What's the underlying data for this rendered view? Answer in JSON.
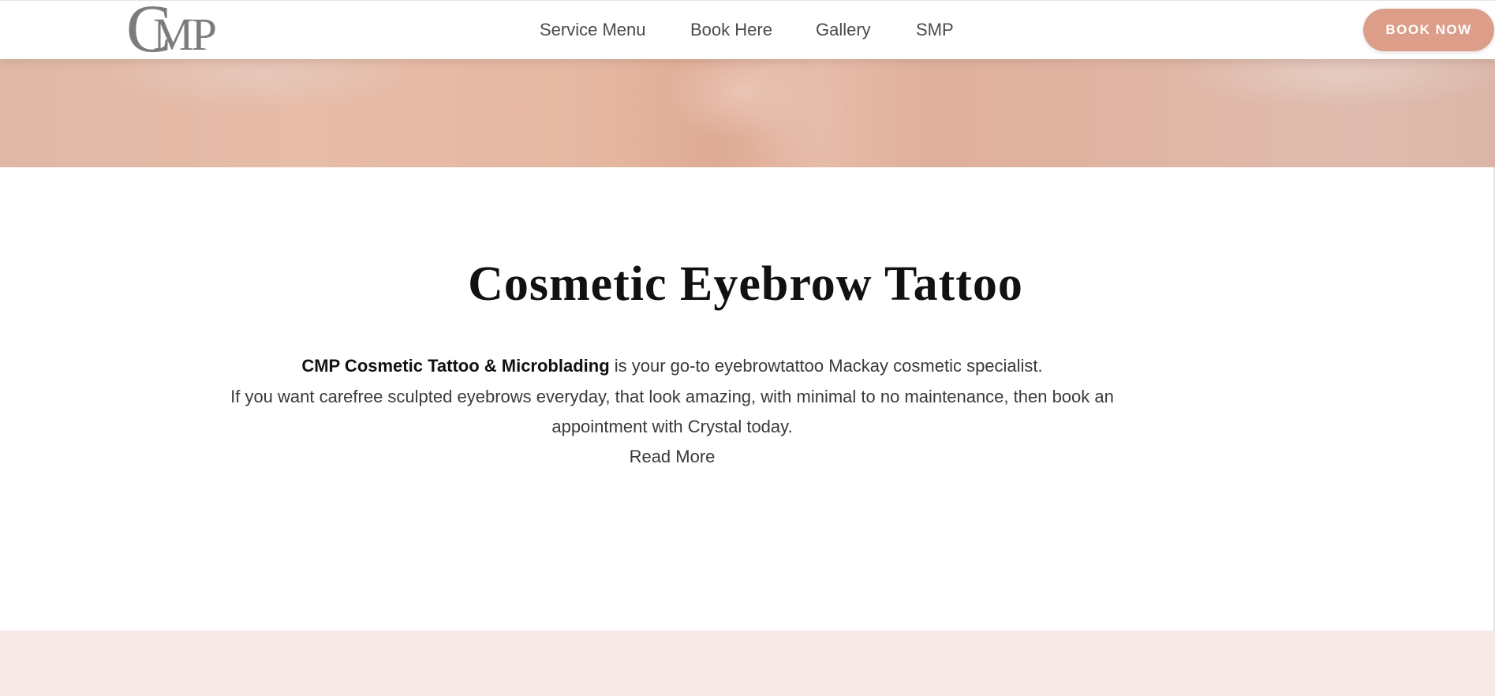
{
  "header": {
    "logo": {
      "letter_c": "C",
      "letters_mp": "MP"
    },
    "nav": [
      {
        "label": "Service Menu"
      },
      {
        "label": "Book Here"
      },
      {
        "label": "Gallery"
      },
      {
        "label": "SMP"
      }
    ],
    "cta_label": "BOOK NOW"
  },
  "colors": {
    "accent": "#dd9e89",
    "band": "#f6e9e6",
    "logo": "#7c7c7c"
  },
  "main": {
    "title": "Cosmetic Eyebrow Tattoo",
    "intro_bold": "CMP Cosmetic Tattoo & Microblading",
    "intro_rest": " is your go-to eyebrowtattoo Mackay cosmetic specialist.",
    "line2": "If you want carefree sculpted eyebrows everyday, that look amazing, with minimal to no maintenance, then book an",
    "line3": "appointment with Crystal today.",
    "read_more": "Read More"
  }
}
